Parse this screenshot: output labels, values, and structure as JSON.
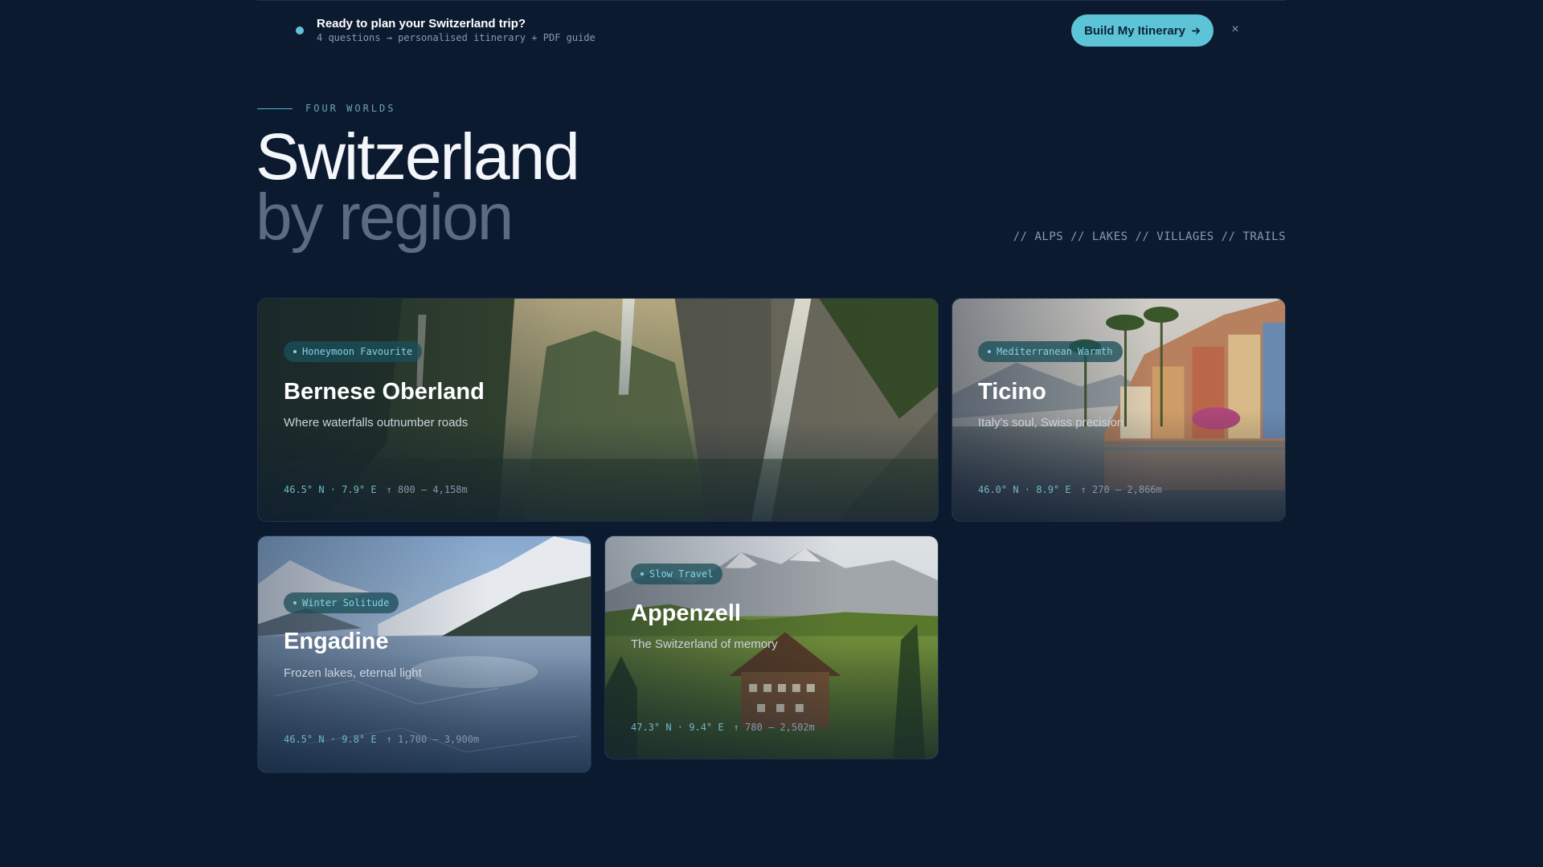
{
  "banner": {
    "title": "Ready to plan your Switzerland trip?",
    "subtitle": "4 questions → personalised itinerary + PDF guide",
    "cta_label": "Build My Itinerary",
    "cta_icon": "arrow-right-icon",
    "close_label": "×"
  },
  "header": {
    "eyebrow": "FOUR WORLDS",
    "title": "Switzerland",
    "subtitle": "by region",
    "tags": "// ALPS // LAKES // VILLAGES // TRAILS"
  },
  "regions": [
    {
      "badge": "Honeymoon Favourite",
      "name": "Bernese Oberland",
      "description": "Where waterfalls outnumber roads",
      "coords": "46.5° N · 7.9° E",
      "altitude": "↑ 800 – 4,158m"
    },
    {
      "badge": "Mediterranean Warmth",
      "name": "Ticino",
      "description": "Italy's soul, Swiss precision",
      "coords": "46.0° N · 8.9° E",
      "altitude": "↑ 270 – 2,866m"
    },
    {
      "badge": "Winter Solitude",
      "name": "Engadine",
      "description": "Frozen lakes, eternal light",
      "coords": "46.5° N · 9.8° E",
      "altitude": "↑ 1,700 – 3,900m"
    },
    {
      "badge": "Slow Travel",
      "name": "Appenzell",
      "description": "The Switzerland of memory",
      "coords": "47.3° N · 9.4° E",
      "altitude": "↑ 780 – 2,502m"
    }
  ],
  "colors": {
    "background": "#0c1a30",
    "accent": "#5cc4d6",
    "badge_text": "#7fd4e2"
  }
}
